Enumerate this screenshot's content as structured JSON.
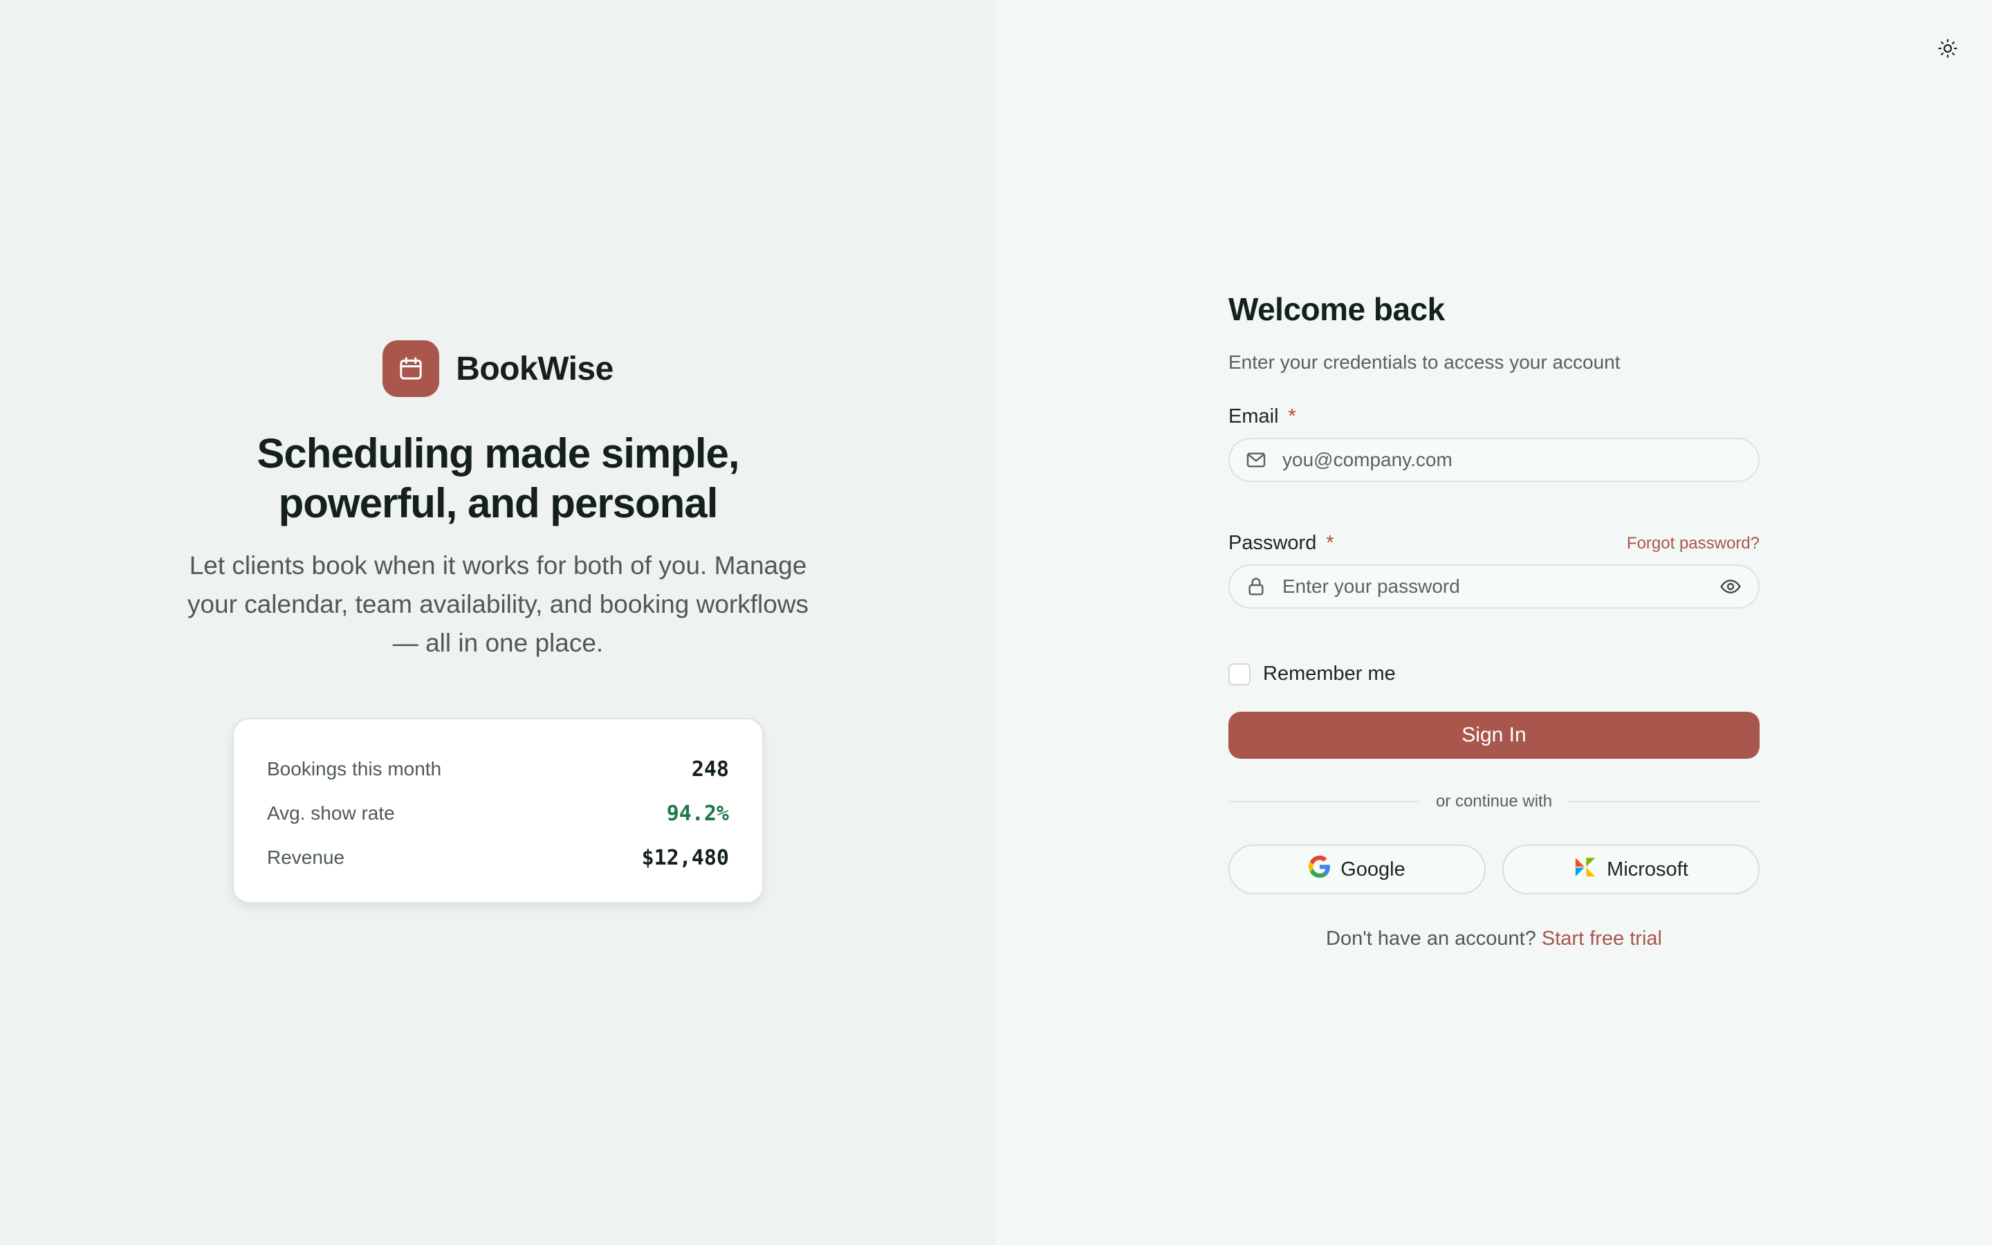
{
  "theme_toggle": {
    "icon": "sun-icon"
  },
  "brand": {
    "name": "BookWise",
    "logo_icon": "calendar-icon",
    "accent": "#a9564d"
  },
  "hero": {
    "headline_line1": "Scheduling made simple,",
    "headline_line2": "powerful, and personal",
    "subcopy": "Let clients book when it works for both of you. Manage your calendar, team availability, and booking workflows — all in one place."
  },
  "stats": [
    {
      "label": "Bookings this month",
      "value": "248"
    },
    {
      "label": "Avg. show rate",
      "value": "94.2%",
      "color": "#1a7a45"
    },
    {
      "label": "Revenue",
      "value": "$12,480"
    }
  ],
  "form": {
    "title": "Welcome back",
    "subtitle": "Enter your credentials to access your account",
    "email": {
      "label": "Email",
      "required_mark": "*",
      "placeholder": "you@company.com",
      "icon": "mail-icon"
    },
    "password": {
      "label": "Password",
      "required_mark": "*",
      "placeholder": "Enter your password",
      "icon": "lock-icon",
      "toggle_icon": "eye-icon",
      "forgot_label": "Forgot password?"
    },
    "remember_label": "Remember me",
    "signin_label": "Sign In",
    "divider_text": "or continue with",
    "google_label": "Google",
    "microsoft_label": "Microsoft",
    "signup_prompt": "Don't have an account?",
    "signup_link": "Start free trial"
  }
}
